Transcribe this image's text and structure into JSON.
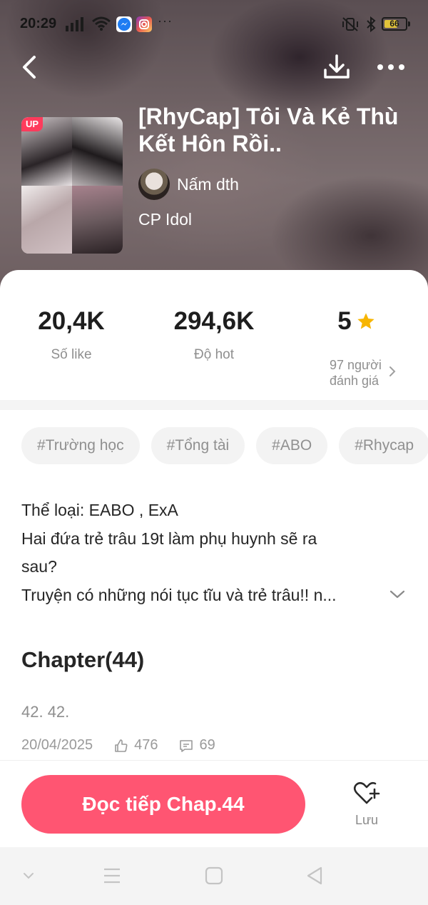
{
  "status_bar": {
    "time": "20:29",
    "battery_level": "66",
    "battery_fraction": 0.66,
    "notification_icons": [
      "messenger-icon",
      "instagram-icon"
    ],
    "more": "···"
  },
  "nav": {
    "back_icon": "chevron-left-icon",
    "download_icon": "download-icon",
    "menu_icon": "more-horizontal-icon"
  },
  "story": {
    "cover_badge": "UP",
    "title": "[RhyCap] Tôi Và Kẻ Thù Kết Hôn Rồi..",
    "author": "Nấm dth",
    "category": "CP Idol"
  },
  "stats": {
    "likes_value": "20,4K",
    "likes_label": "Số like",
    "hot_value": "294,6K",
    "hot_label": "Độ hot",
    "rating_value": "5",
    "rating_count_line1": "97 người",
    "rating_count_line2": "đánh giá"
  },
  "tags": [
    "#Trường học",
    "#Tổng tài",
    "#ABO",
    "#Rhycap"
  ],
  "description": {
    "line1": "Thể loại: EABO , ExA",
    "line2": "Hai đứa trẻ trâu 19t làm phụ huynh sẽ ra",
    "line3": "sau?",
    "line4": "Truyện có những nói tục tĩu và trẻ trâu!! n..."
  },
  "chapters": {
    "heading": "Chapter(44)",
    "latest": {
      "title": "42. 42.",
      "date": "20/04/2025",
      "likes": "476",
      "comments": "69"
    }
  },
  "actions": {
    "read_label": "Đọc tiếp Chap.44",
    "save_label": "Lưu"
  },
  "colors": {
    "accent": "#ff5572",
    "star": "#f7b500",
    "badge": "#ff3b5c"
  }
}
